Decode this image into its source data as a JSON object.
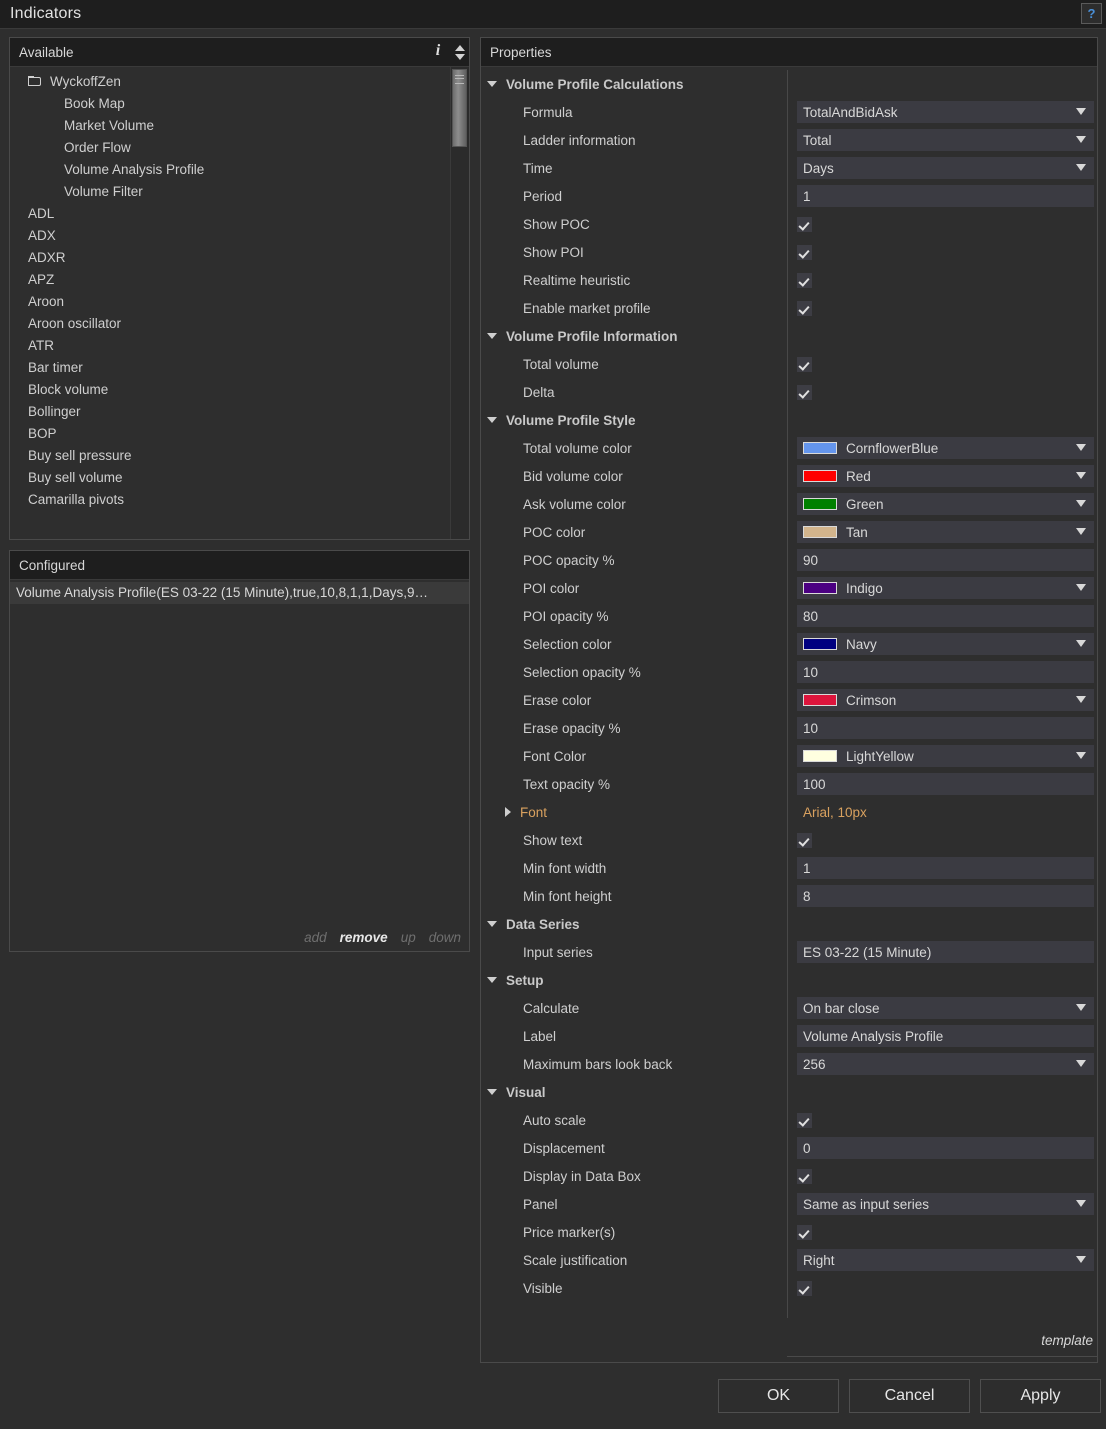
{
  "window": {
    "title": "Indicators",
    "help_icon": "question-mark-icon"
  },
  "available": {
    "header": "Available",
    "info_icon": "info-icon",
    "items": [
      {
        "label": "WyckoffZen",
        "type": "folder"
      },
      {
        "label": "Book Map",
        "type": "child"
      },
      {
        "label": "Market Volume",
        "type": "child"
      },
      {
        "label": "Order Flow",
        "type": "child"
      },
      {
        "label": "Volume Analysis Profile",
        "type": "child"
      },
      {
        "label": "Volume Filter",
        "type": "child"
      },
      {
        "label": "ADL",
        "type": "item"
      },
      {
        "label": "ADX",
        "type": "item"
      },
      {
        "label": "ADXR",
        "type": "item"
      },
      {
        "label": "APZ",
        "type": "item"
      },
      {
        "label": "Aroon",
        "type": "item"
      },
      {
        "label": "Aroon oscillator",
        "type": "item"
      },
      {
        "label": "ATR",
        "type": "item"
      },
      {
        "label": "Bar timer",
        "type": "item"
      },
      {
        "label": "Block volume",
        "type": "item"
      },
      {
        "label": "Bollinger",
        "type": "item"
      },
      {
        "label": "BOP",
        "type": "item"
      },
      {
        "label": "Buy sell pressure",
        "type": "item"
      },
      {
        "label": "Buy sell volume",
        "type": "item"
      },
      {
        "label": "Camarilla pivots",
        "type": "item"
      }
    ]
  },
  "configured": {
    "header": "Configured",
    "items": [
      "Volume Analysis Profile(ES 03-22 (15 Minute),true,10,8,1,1,Days,9…"
    ],
    "actions": [
      {
        "label": "add",
        "enabled": false
      },
      {
        "label": "remove",
        "enabled": true
      },
      {
        "label": "up",
        "enabled": false
      },
      {
        "label": "down",
        "enabled": false
      }
    ]
  },
  "properties": {
    "header": "Properties",
    "template_link": "template",
    "groups": [
      {
        "title": "Volume Profile Calculations",
        "rows": [
          {
            "label": "Formula",
            "kind": "combo",
            "value": "TotalAndBidAsk"
          },
          {
            "label": "Ladder information",
            "kind": "combo",
            "value": "Total"
          },
          {
            "label": "Time",
            "kind": "combo",
            "value": "Days"
          },
          {
            "label": "Period",
            "kind": "text",
            "value": "1"
          },
          {
            "label": "Show POC",
            "kind": "checkbox",
            "value": true
          },
          {
            "label": "Show POI",
            "kind": "checkbox",
            "value": true
          },
          {
            "label": "Realtime heuristic",
            "kind": "checkbox",
            "value": true
          },
          {
            "label": "Enable market profile",
            "kind": "checkbox",
            "value": true
          }
        ]
      },
      {
        "title": "Volume Profile Information",
        "rows": [
          {
            "label": "Total volume",
            "kind": "checkbox",
            "value": true
          },
          {
            "label": "Delta",
            "kind": "checkbox",
            "value": true
          }
        ]
      },
      {
        "title": "Volume Profile Style",
        "rows": [
          {
            "label": "Total volume color",
            "kind": "color",
            "value": "CornflowerBlue",
            "color": "#6495ED"
          },
          {
            "label": "Bid volume color",
            "kind": "color",
            "value": "Red",
            "color": "#FF0000"
          },
          {
            "label": "Ask volume color",
            "kind": "color",
            "value": "Green",
            "color": "#008000"
          },
          {
            "label": "POC color",
            "kind": "color",
            "value": "Tan",
            "color": "#D2B48C"
          },
          {
            "label": "POC opacity %",
            "kind": "text",
            "value": "90"
          },
          {
            "label": "POI color",
            "kind": "color",
            "value": "Indigo",
            "color": "#4B0082"
          },
          {
            "label": "POI opacity %",
            "kind": "text",
            "value": "80"
          },
          {
            "label": "Selection color",
            "kind": "color",
            "value": "Navy",
            "color": "#000080"
          },
          {
            "label": "Selection opacity %",
            "kind": "text",
            "value": "10"
          },
          {
            "label": "Erase color",
            "kind": "color",
            "value": "Crimson",
            "color": "#DC143C"
          },
          {
            "label": "Erase opacity %",
            "kind": "text",
            "value": "10"
          },
          {
            "label": "Font Color",
            "kind": "color",
            "value": "LightYellow",
            "color": "#FFFFE0"
          },
          {
            "label": "Text opacity %",
            "kind": "text",
            "value": "100"
          },
          {
            "label": "Font",
            "kind": "expandable",
            "value": "Arial, 10px"
          },
          {
            "label": "Show text",
            "kind": "checkbox",
            "value": true
          },
          {
            "label": "Min font width",
            "kind": "text",
            "value": "1"
          },
          {
            "label": "Min font height",
            "kind": "text",
            "value": "8"
          }
        ]
      },
      {
        "title": "Data Series",
        "rows": [
          {
            "label": "Input series",
            "kind": "text",
            "value": "ES 03-22 (15 Minute)"
          }
        ]
      },
      {
        "title": "Setup",
        "rows": [
          {
            "label": "Calculate",
            "kind": "combo",
            "value": "On bar close"
          },
          {
            "label": "Label",
            "kind": "text",
            "value": "Volume Analysis Profile"
          },
          {
            "label": "Maximum bars look back",
            "kind": "combo",
            "value": "256"
          }
        ]
      },
      {
        "title": "Visual",
        "rows": [
          {
            "label": "Auto scale",
            "kind": "checkbox",
            "value": true
          },
          {
            "label": "Displacement",
            "kind": "text",
            "value": "0"
          },
          {
            "label": "Display in Data Box",
            "kind": "checkbox",
            "value": true
          },
          {
            "label": "Panel",
            "kind": "combo",
            "value": "Same as input series"
          },
          {
            "label": "Price marker(s)",
            "kind": "checkbox",
            "value": true
          },
          {
            "label": "Scale justification",
            "kind": "combo",
            "value": "Right"
          },
          {
            "label": "Visible",
            "kind": "checkbox",
            "value": true
          }
        ]
      }
    ]
  },
  "footer": {
    "buttons": [
      {
        "label": "OK",
        "name": "ok-button"
      },
      {
        "label": "Cancel",
        "name": "cancel-button"
      },
      {
        "label": "Apply",
        "name": "apply-button"
      }
    ]
  }
}
